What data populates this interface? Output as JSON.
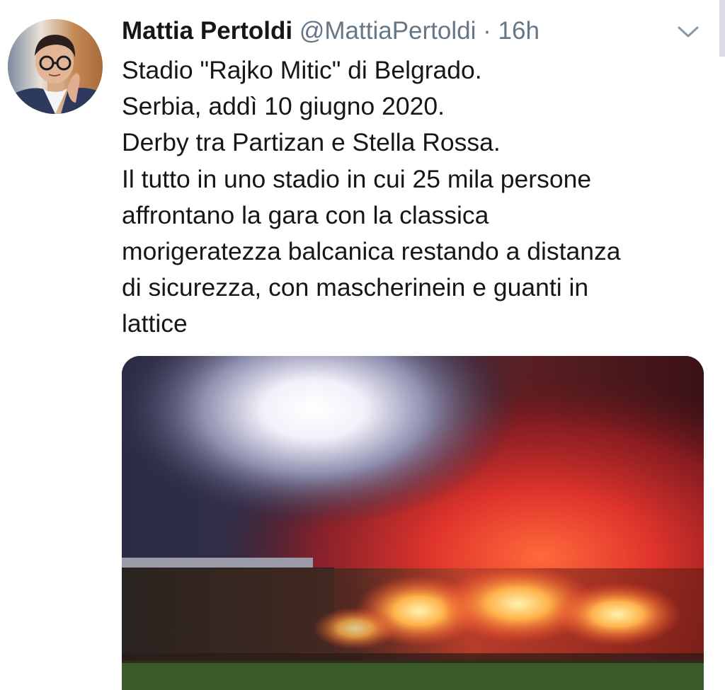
{
  "tweet": {
    "author_name": "Mattia Pertoldi",
    "handle": "@MattiaPertoldi",
    "separator": "·",
    "timestamp": "16h",
    "text_lines": [
      "Stadio \"Rajko Mitic\" di Belgrado.",
      "Serbia, addì 10 giugno 2020.",
      "Derby tra Partizan e Stella Rossa.",
      "Il tutto in uno stadio in cui 25 mila persone",
      "affrontano la gara con la classica",
      "morigeratezza balcanica restando a distanza",
      "di sicurezza, con mascherinein e guanti in",
      "lattice"
    ]
  },
  "icons": {
    "menu": "chevron-down-icon",
    "avatar": "profile-photo"
  },
  "colors": {
    "text": "#14171a",
    "secondary": "#657786",
    "background": "#ffffff"
  }
}
